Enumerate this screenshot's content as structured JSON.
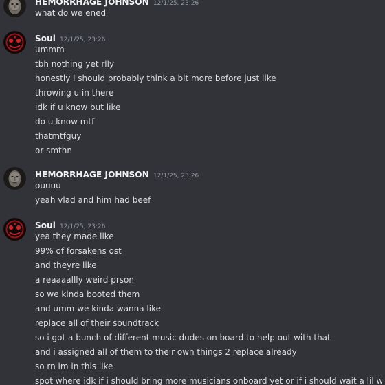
{
  "colors": {
    "background": "#313338",
    "author": "#f2f3f5",
    "timestamp": "#949ba4",
    "text": "#dbdee1"
  },
  "messages": [
    {
      "author": "HEMORRHAGE JOHNSON",
      "timestamp": "12/1/25, 23:26",
      "avatar": "face-avatar",
      "lines": [
        "what do we ened"
      ]
    },
    {
      "author": "Soul",
      "timestamp": "12/1/25, 23:26",
      "avatar": "red-emblem-avatar",
      "lines": [
        "ummm",
        "tbh nothing yet rlly",
        "honestly i should probably think a bit more before just like",
        "throwing u in there",
        "idk if u know but like",
        "do u know mtf",
        "thatmtfguy",
        "or smthn"
      ]
    },
    {
      "author": "HEMORRHAGE JOHNSON",
      "timestamp": "12/1/25, 23:26",
      "avatar": "face-avatar",
      "lines": [
        "ouuuu",
        "yeah vlad and him had beef"
      ]
    },
    {
      "author": "Soul",
      "timestamp": "12/1/25, 23:26",
      "avatar": "red-emblem-avatar",
      "lines": [
        "yea they made like",
        "99% of forsakens ost",
        "and theyre like",
        "a reaaaallly weird prson",
        "so we kinda booted them",
        "and umm we kinda wanna like",
        "replace all of their soundtrack",
        "so i got a bunch of different music dudes on board to help out with that",
        "and i assigned all of them to their own things 2 replace already",
        "so rn im in this like",
        "spot where idk if i should bring more musicians onboard yet or if i should wait a lil while"
      ]
    }
  ]
}
